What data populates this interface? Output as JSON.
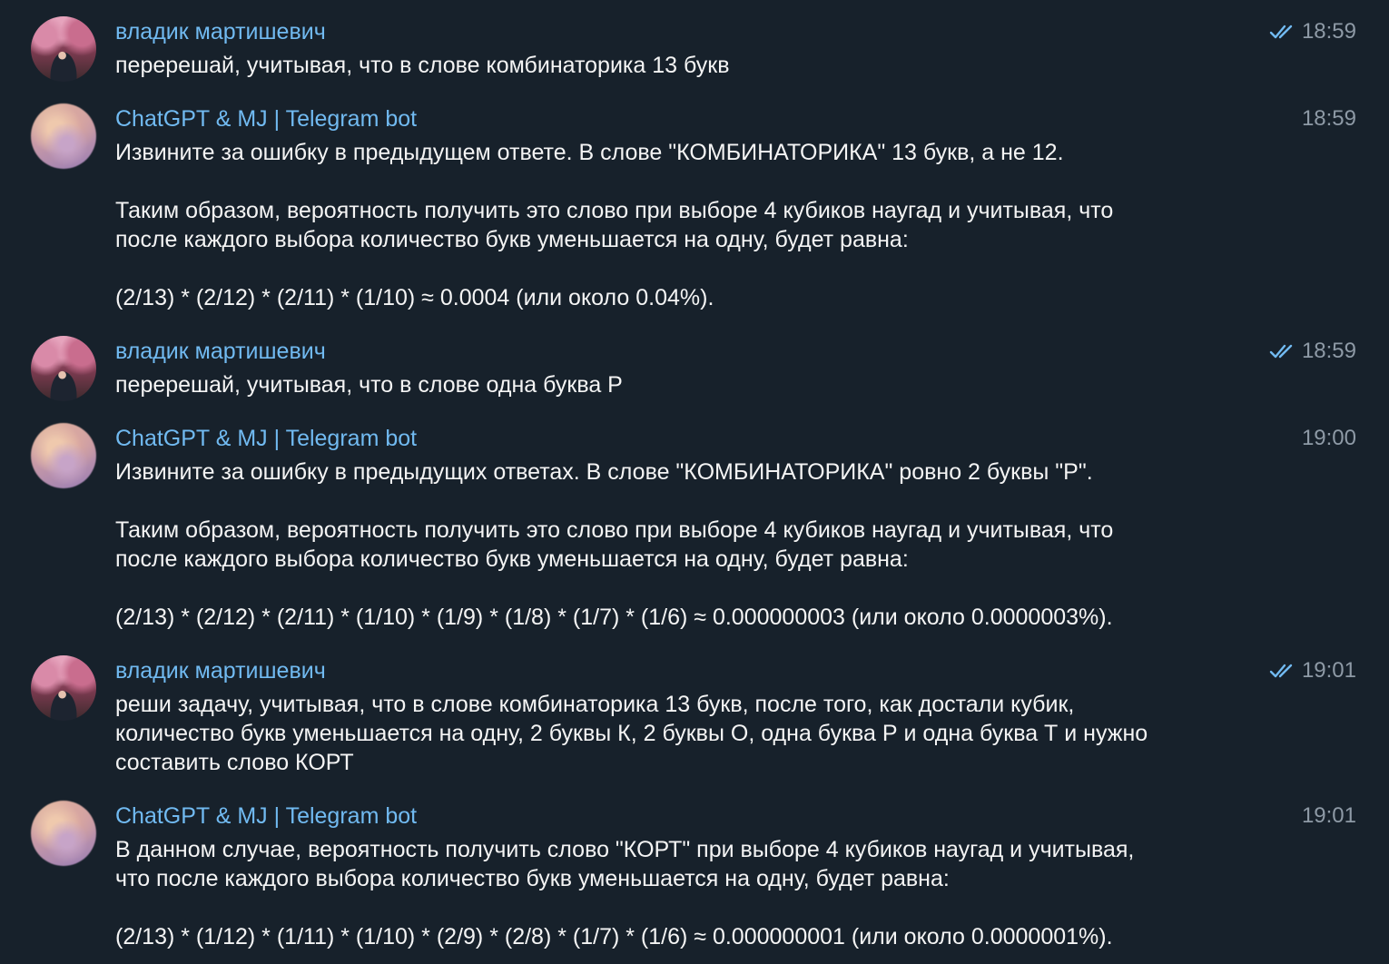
{
  "messages": [
    {
      "sender": "владик мартишевич",
      "time": "18:59",
      "read": true,
      "paragraphs": [
        "перерешай, учитывая, что в слове комбинаторика 13 букв"
      ]
    },
    {
      "sender": "ChatGPT & MJ | Telegram bot",
      "time": "18:59",
      "read": false,
      "paragraphs": [
        "Извините за ошибку в предыдущем ответе. В слове \"КОМБИНАТОРИКА\" 13 букв, а не 12.",
        "Таким образом, вероятность получить это слово при выборе 4 кубиков наугад и учитывая, что\nпосле каждого выбора количество букв уменьшается на одну, будет равна:",
        "(2/13) * (2/12) * (2/11) * (1/10) ≈ 0.0004 (или около 0.04%)."
      ]
    },
    {
      "sender": "владик мартишевич",
      "time": "18:59",
      "read": true,
      "paragraphs": [
        "перерешай, учитывая, что в слове одна буква Р"
      ]
    },
    {
      "sender": "ChatGPT & MJ | Telegram bot",
      "time": "19:00",
      "read": false,
      "paragraphs": [
        "Извините за ошибку в предыдущих ответах. В слове \"КОМБИНАТОРИКА\" ровно 2 буквы \"Р\".",
        "Таким образом, вероятность получить это слово при выборе 4 кубиков наугад и учитывая, что\nпосле каждого выбора количество букв уменьшается на одну, будет равна:",
        "(2/13) * (2/12) * (2/11) * (1/10) * (1/9) * (1/8) * (1/7) * (1/6) ≈ 0.000000003 (или около 0.0000003%)."
      ]
    },
    {
      "sender": "владик мартишевич",
      "time": "19:01",
      "read": true,
      "paragraphs": [
        "реши задачу, учитывая, что в слове комбинаторика 13 букв, после того, как достали кубик,\nколичество букв уменьшается на одну, 2 буквы К, 2 буквы О, одна буква Р и одна буква Т и нужно\nсоставить слово КОРТ"
      ]
    },
    {
      "sender": "ChatGPT & MJ | Telegram bot",
      "time": "19:01",
      "read": false,
      "paragraphs": [
        "В данном случае, вероятность получить слово \"КОРТ\" при выборе 4 кубиков наугад и учитывая,\nчто после каждого выбора количество букв уменьшается на одну, будет равна:",
        "(2/13) * (1/12) * (1/11) * (1/10) * (2/9) * (2/8) * (1/7) * (1/6) ≈ 0.000000001 (или около 0.0000001%)."
      ]
    }
  ],
  "colors": {
    "background": "#17212b",
    "sender": "#71baf1",
    "time": "#8e9aa6",
    "checks": "#71baf1",
    "text": "#f4f4f4"
  },
  "icons": {
    "read": "double-check-icon"
  }
}
